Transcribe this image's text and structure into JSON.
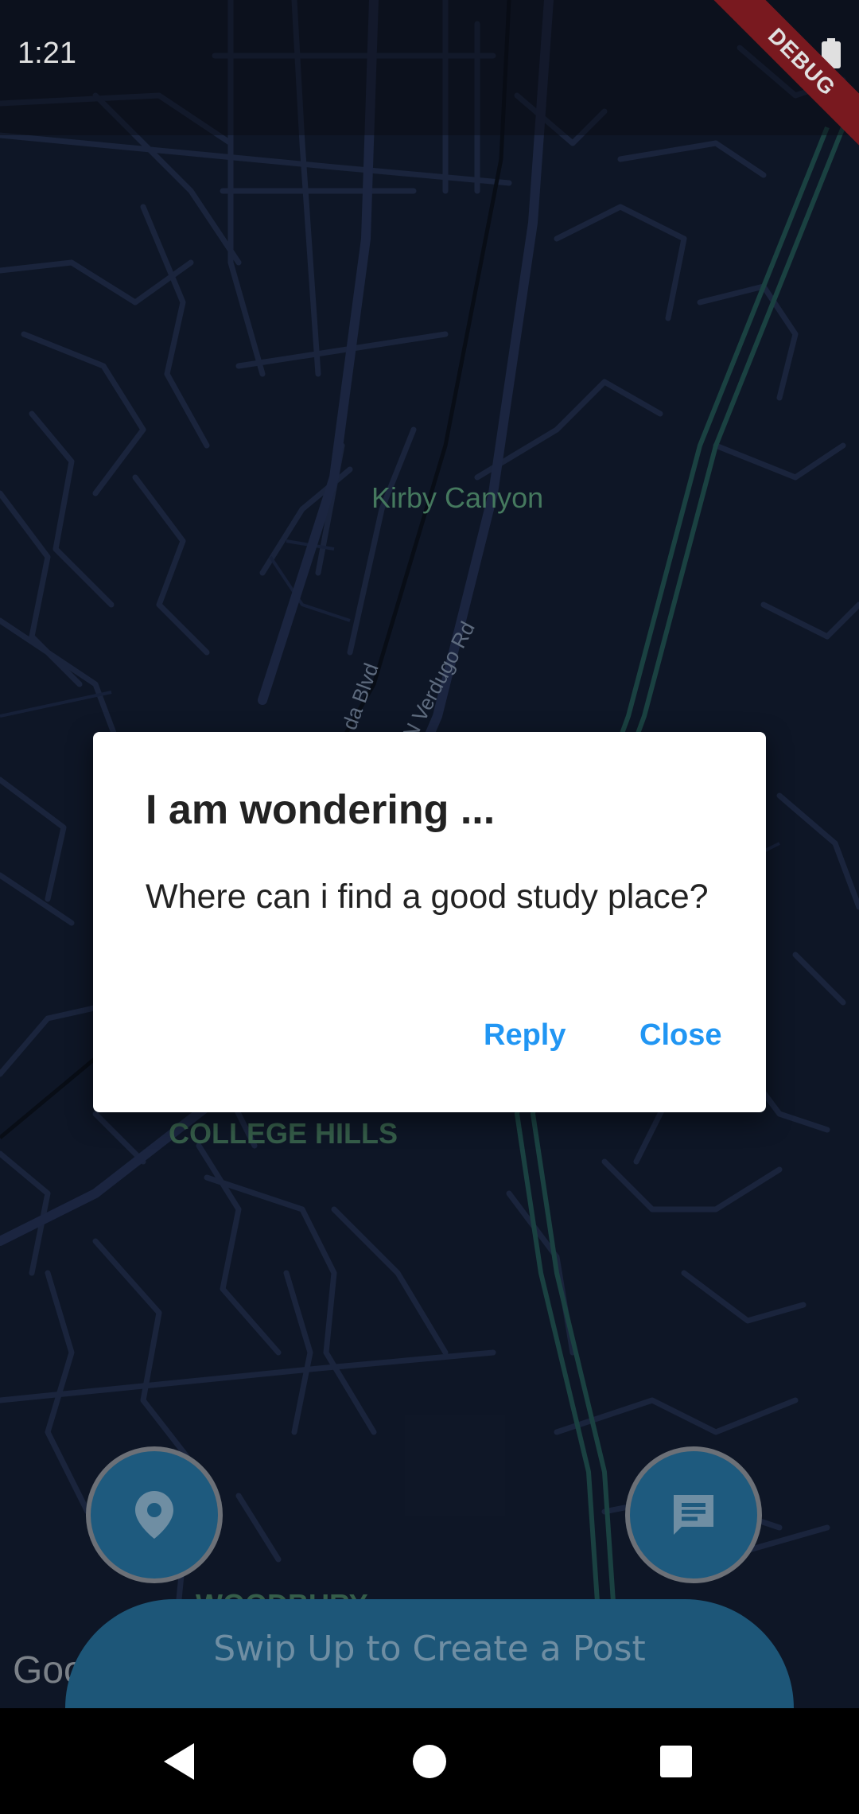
{
  "status_bar": {
    "time": "1:21",
    "battery_icon": "battery-full-icon"
  },
  "debug_banner": "DEBUG",
  "map": {
    "labels": {
      "kirby_canyon": "Kirby Canyon",
      "da_blvd": "da Blvd",
      "verdugo_rd": "N Verdugo Rd",
      "college_hills": "COLLEGE HILLS",
      "woodbury": "WOODBURY",
      "google": "Goo"
    }
  },
  "dialog": {
    "title": "I am wondering ...",
    "body": "Where can i find a good study place?",
    "reply_label": "Reply",
    "close_label": "Close"
  },
  "fabs": {
    "left_icon": "location-pin-icon",
    "right_icon": "chat-message-icon"
  },
  "bottom_panel": {
    "label": "Swip Up to Create a Post"
  },
  "nav": {
    "back_icon": "back-icon",
    "home_icon": "home-icon",
    "recents_icon": "recents-icon"
  },
  "colors": {
    "map_bg": "#111a2c",
    "accent_blue": "#2196f3",
    "panel_blue": "#1d5678",
    "debug_red": "#8a1d24"
  }
}
